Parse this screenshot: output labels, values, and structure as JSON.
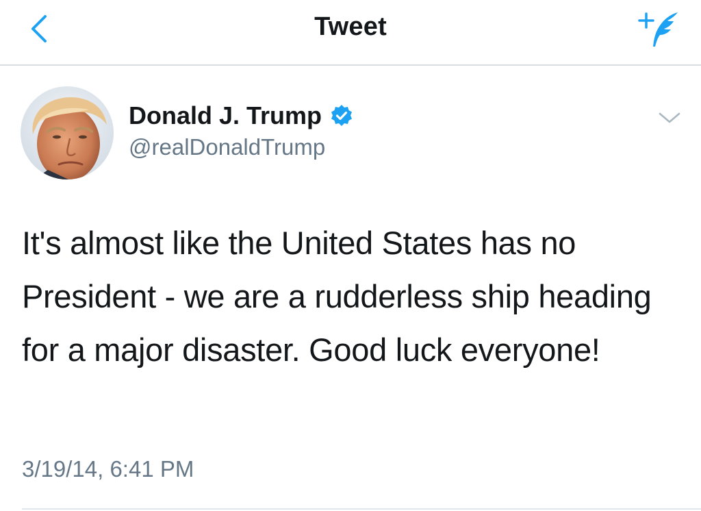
{
  "nav": {
    "title": "Tweet",
    "back_icon": "chevron-left-icon",
    "compose_icon": "compose-tweet-icon"
  },
  "tweet": {
    "author_name": "Donald J. Trump",
    "author_handle": "@realDonaldTrump",
    "verified": true,
    "text": "It's almost like the United States has no President - we are a rudderless ship heading for a major disaster. Good luck everyone!",
    "timestamp": "3/19/14, 6:41 PM"
  },
  "colors": {
    "accent": "#1da1f2",
    "text_primary": "#14171a",
    "text_secondary": "#657786",
    "divider": "#dadde0"
  }
}
